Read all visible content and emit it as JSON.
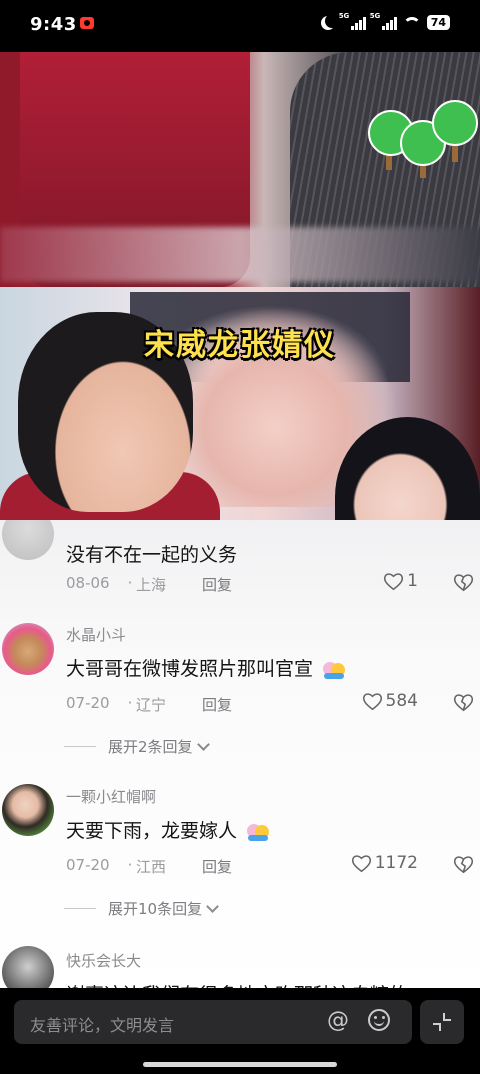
{
  "status_bar": {
    "time": "9:43",
    "signal1_label": "5G",
    "signal2_label": "5G",
    "battery": "74"
  },
  "video": {
    "caption": "宋威龙张婧仪"
  },
  "comments": [
    {
      "name": "",
      "text": "没有不在一起的义务",
      "date": "08-06",
      "location": "上海",
      "reply": "回复",
      "likes": "1"
    },
    {
      "name": "水晶小斗",
      "text": "大哥哥在微博发照片那叫官宣",
      "date": "07-20",
      "location": "辽宁",
      "reply": "回复",
      "likes": "584",
      "expand": "展开2条回复"
    },
    {
      "name": "一颗小红帽啊",
      "text": "天要下雨，龙要嫁人",
      "date": "07-20",
      "location": "江西",
      "reply": "回复",
      "likes": "1172",
      "expand": "展开10条回复"
    },
    {
      "name": "快乐会长大",
      "text": "谢事这边我们有很多地方昨那种这自糖的"
    }
  ],
  "input": {
    "placeholder": "友善评论，文明发言"
  },
  "icons": {
    "heart": "heart-icon",
    "dislike": "broken-heart-icon",
    "at": "at-icon",
    "emoji": "smile-icon",
    "expand": "expand-icon"
  }
}
